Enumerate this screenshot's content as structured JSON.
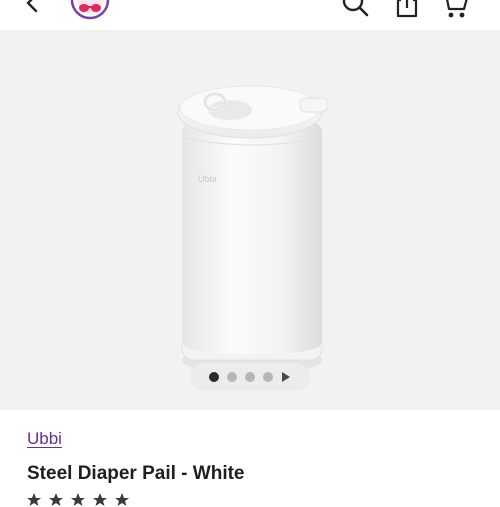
{
  "header": {
    "back_icon": "chevron-left-icon",
    "logo_icon": "brand-logo-icon",
    "actions": [
      "search-icon",
      "share-icon",
      "cart-icon"
    ]
  },
  "gallery": {
    "image_alt_icon": "diaper-pail-image",
    "slide_count": 4,
    "active_slide": 1,
    "has_video": true,
    "colors": {
      "background": "#f2f2f2",
      "dot_active": "#2b2b2b",
      "dot_inactive": "#b5b5b5"
    }
  },
  "product": {
    "brand": "Ubbi",
    "title": "Steel Diaper Pail - White",
    "image_text": "Ubbi",
    "brand_color": "#6b2c91"
  }
}
